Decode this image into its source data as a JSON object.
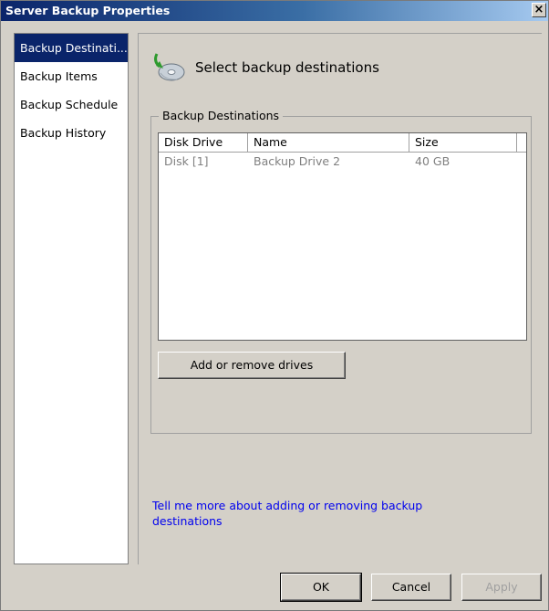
{
  "window": {
    "title": "Server Backup Properties",
    "close_glyph": "×"
  },
  "sidebar": {
    "items": [
      {
        "label": "Backup Destinati...",
        "selected": true
      },
      {
        "label": "Backup Items",
        "selected": false
      },
      {
        "label": "Backup Schedule",
        "selected": false
      },
      {
        "label": "Backup History",
        "selected": false
      }
    ]
  },
  "content": {
    "header_icon": "backup-destination-icon",
    "header_text": "Select backup destinations",
    "group_label": "Backup Destinations",
    "columns": [
      "Disk Drive",
      "Name",
      "Size"
    ],
    "rows": [
      {
        "disk": "Disk [1]",
        "name": "Backup Drive 2",
        "size": "40 GB"
      }
    ],
    "add_remove_button": "Add or remove drives",
    "help_link": "Tell me more about adding or removing backup destinations"
  },
  "footer": {
    "ok": "OK",
    "cancel": "Cancel",
    "apply": "Apply",
    "apply_enabled": false
  },
  "colors": {
    "selection": "#0a246a",
    "link": "#0000ee",
    "dialog_bg": "#d4d0c8"
  }
}
